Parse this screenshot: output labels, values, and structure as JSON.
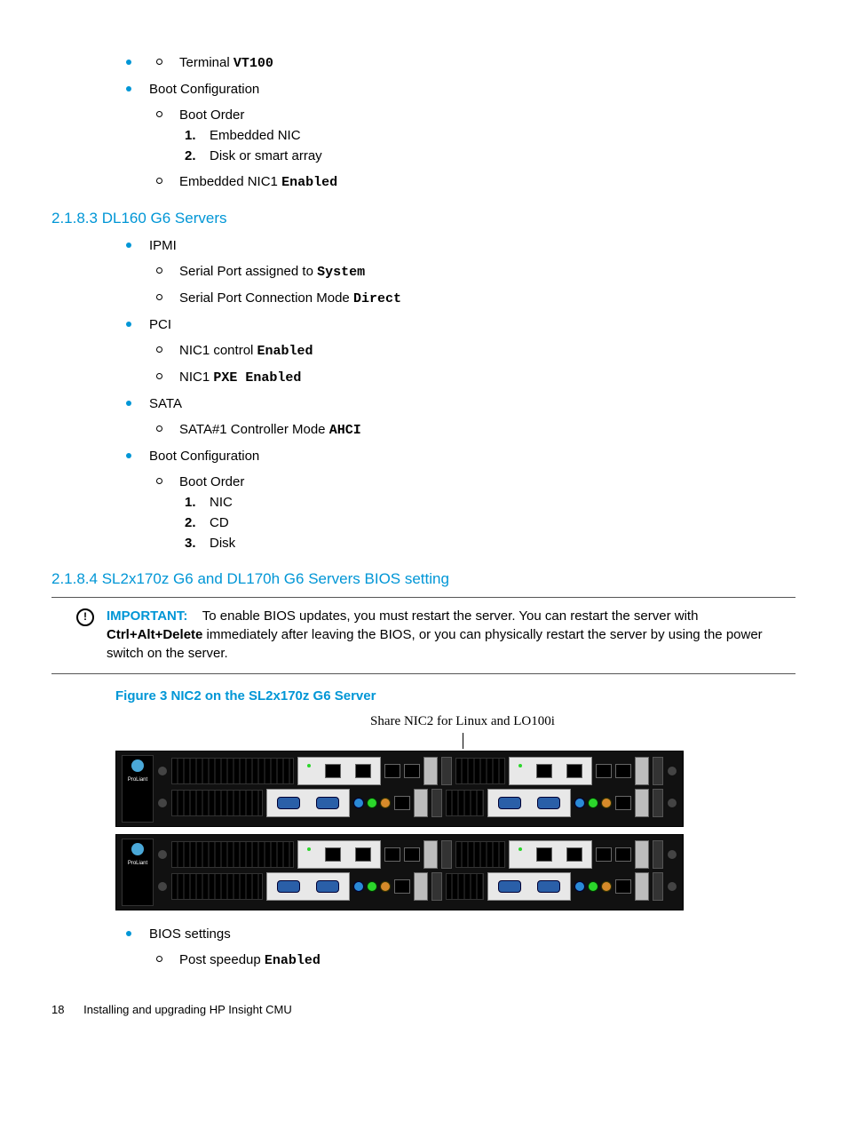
{
  "top_list": {
    "terminal_prefix": "Terminal ",
    "terminal_code": "VT100",
    "boot_cfg": "Boot Configuration",
    "boot_order": "Boot Order",
    "bo_items": [
      "Embedded NIC",
      "Disk or smart array"
    ],
    "emb_nic_prefix": "Embedded NIC1 ",
    "emb_nic_code": "Enabled"
  },
  "section_2183": {
    "title": "2.1.8.3 DL160 G6 Servers",
    "ipmi": "IPMI",
    "ipmi_sp_prefix": "Serial Port assigned to ",
    "ipmi_sp_code": "System",
    "ipmi_cm_prefix": "Serial Port Connection Mode ",
    "ipmi_cm_code": "Direct",
    "pci": "PCI",
    "pci_nic1_prefix": "NIC1 control ",
    "pci_nic1_code": "Enabled",
    "pci_nic1b_prefix": "NIC1 ",
    "pci_nic1b_code": "PXE Enabled",
    "sata": "SATA",
    "sata_prefix": "SATA#1 Controller Mode ",
    "sata_code": "AHCI",
    "boot_cfg": "Boot Configuration",
    "boot_order": "Boot Order",
    "bo_items": [
      "NIC",
      "CD",
      "Disk"
    ]
  },
  "section_2184": {
    "title": "2.1.8.4 SL2x170z G6 and DL170h G6 Servers BIOS setting",
    "important_label": "IMPORTANT:",
    "important_pre": "To enable BIOS updates, you must restart the server. You can restart the server with ",
    "important_kbd": "Ctrl+Alt+Delete",
    "important_post": " immediately after leaving the BIOS, or you can physically restart the server by using the power switch on the server.",
    "figure_title": "Figure 3 NIC2 on the SL2x170z G6 Server",
    "figure_caption": "Share NIC2 for Linux and LO100i",
    "bios": "BIOS settings",
    "post_prefix": "Post speedup ",
    "post_code": "Enabled"
  },
  "footer": {
    "page": "18",
    "title": "Installing and upgrading HP Insight CMU"
  }
}
